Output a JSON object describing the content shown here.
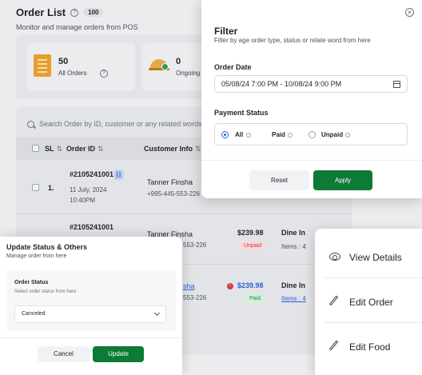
{
  "order_list": {
    "title": "Order List",
    "count": "100",
    "subtitle": "Monitor and manage orders from POS",
    "stats": [
      {
        "value": "50",
        "label": "All Orders"
      },
      {
        "value": "0",
        "label": "Ongoing"
      }
    ]
  },
  "table": {
    "search_placeholder": "Search Order by ID, customer or any related words",
    "headers": {
      "sl": "SL",
      "order_id": "Order ID",
      "customer": "Customer Info"
    },
    "rows": [
      {
        "sl": "1.",
        "order_id": "#2105241001",
        "date": "11 July, 2024",
        "time": "10:40PM",
        "customer_name": "Tanner Finsha",
        "customer_phone": "+995-445-553-226"
      },
      {
        "order_id": "#2105241001",
        "customer_name": "Tanner Finsha",
        "customer_phone": "553-226",
        "amount": "$239.98",
        "payment": "Unpaid",
        "type": "Dine In",
        "items": "Items : 4"
      },
      {
        "customer_name": "sha",
        "customer_phone": "553-226",
        "amount": "$239.98",
        "payment": "Paid",
        "type": "Dine In",
        "items": "Items : 4"
      }
    ]
  },
  "filter": {
    "close_icon": "close-icon",
    "title": "Filter",
    "subtitle": "Filter by age order type, status or relate word from here",
    "order_date_label": "Order Date",
    "date_range": "05/08/24 7:00 PM - 10/08/24 9:00 PM",
    "payment_label": "Payment Status",
    "options": [
      "All",
      "Paid",
      "Unpaid"
    ],
    "selected": "All",
    "reset": "Reset",
    "apply": "Apply"
  },
  "status_panel": {
    "title": "Update Status & Others",
    "subtitle": "Manage order from here",
    "field_label": "Order Status",
    "field_hint": "Select order status from here",
    "selected": "Canceled",
    "cancel": "Cancel",
    "update": "Update"
  },
  "menu": {
    "items": [
      {
        "label": "View Details",
        "icon": "eye-icon"
      },
      {
        "label": "Edit Order",
        "icon": "pencil-icon"
      },
      {
        "label": "Edit Food",
        "icon": "pencil-icon"
      }
    ]
  },
  "colors": {
    "primary_green": "#0d7a35",
    "link_blue": "#2b63d6",
    "unpaid_red": "#d23b3b",
    "paid_green": "#1f8a43"
  }
}
